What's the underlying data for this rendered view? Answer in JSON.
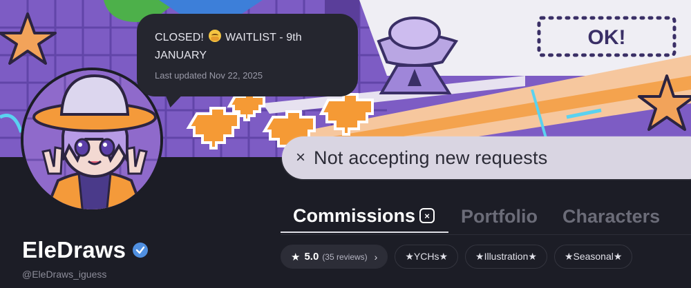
{
  "status": {
    "line_before_emoji": "CLOSED!",
    "emoji_icon": "hugging-face-emoji",
    "line_after_emoji": "WAITLIST - 9th JANUARY",
    "updated": "Last updated Nov 22, 2025"
  },
  "banner": {
    "sign_text": "OK!"
  },
  "requests": {
    "icon": "x-icon",
    "close_glyph": "×",
    "text": "Not accepting new requests"
  },
  "tabs": [
    {
      "label": "Commissions",
      "badge_glyph": "×",
      "active": true
    },
    {
      "label": "Portfolio",
      "active": false
    },
    {
      "label": "Characters",
      "active": false
    }
  ],
  "rating": {
    "star_glyph": "★",
    "value": "5.0",
    "reviews": "(35 reviews)",
    "chevron_glyph": "›"
  },
  "tags": [
    "★YCHs★",
    "★Illustration★",
    "★Seasonal★"
  ],
  "profile": {
    "name": "EleDraws",
    "handle": "@EleDraws_iguess",
    "verified": true
  },
  "colors": {
    "background": "#1c1d26",
    "banner_purple": "#7d5cc4",
    "accent_orange": "#f49a3a",
    "verified_blue": "#4f8fe0"
  }
}
